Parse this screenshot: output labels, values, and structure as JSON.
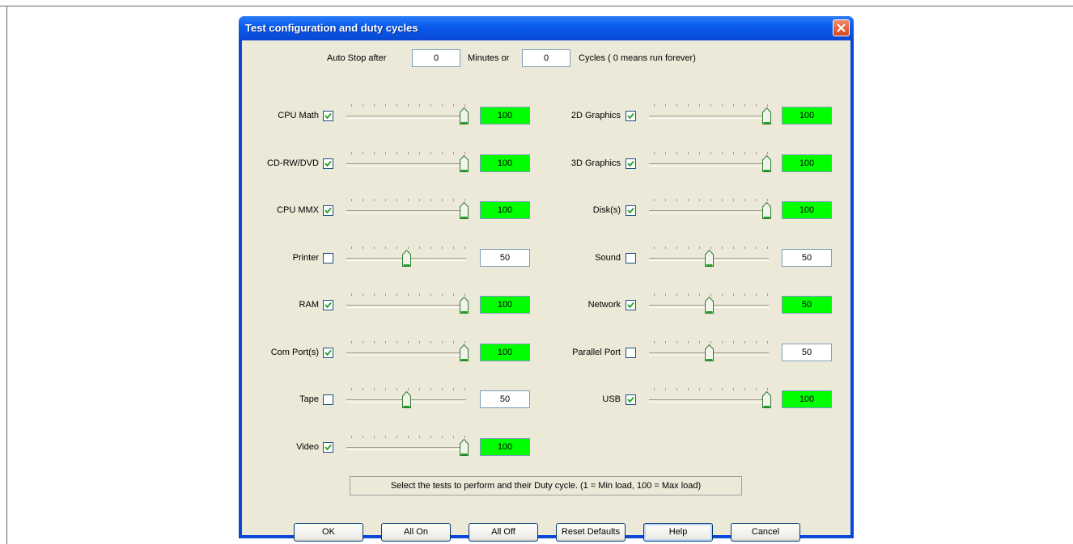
{
  "window": {
    "title": "Test configuration and duty cycles"
  },
  "autostop": {
    "label_before": "Auto Stop after",
    "minutes_value": "0",
    "label_middle": "Minutes or",
    "cycles_value": "0",
    "label_after": "Cycles ( 0 means run forever)"
  },
  "left_tests": [
    {
      "label": "CPU Math",
      "checked": true,
      "value": 100
    },
    {
      "label": "CD-RW/DVD",
      "checked": true,
      "value": 100
    },
    {
      "label": "CPU MMX",
      "checked": true,
      "value": 100
    },
    {
      "label": "Printer",
      "checked": false,
      "value": 50
    },
    {
      "label": "RAM",
      "checked": true,
      "value": 100
    },
    {
      "label": "Com Port(s)",
      "checked": true,
      "value": 100
    },
    {
      "label": "Tape",
      "checked": false,
      "value": 50
    },
    {
      "label": "Video",
      "checked": true,
      "value": 100
    }
  ],
  "right_tests": [
    {
      "label": "2D Graphics",
      "checked": true,
      "value": 100
    },
    {
      "label": "3D Graphics",
      "checked": true,
      "value": 100
    },
    {
      "label": "Disk(s)",
      "checked": true,
      "value": 100
    },
    {
      "label": "Sound",
      "checked": false,
      "value": 50
    },
    {
      "label": "Network",
      "checked": true,
      "value": 50
    },
    {
      "label": "Parallel Port",
      "checked": false,
      "value": 50
    },
    {
      "label": "USB",
      "checked": true,
      "value": 100
    }
  ],
  "info": "Select the tests to perform and their Duty cycle. (1 = Min load, 100 = Max load)",
  "buttons": {
    "ok": "OK",
    "all_on": "All On",
    "all_off": "All Off",
    "reset_defaults": "Reset Defaults",
    "help": "Help",
    "cancel": "Cancel"
  },
  "colors": {
    "enabled_value_bg": "#00ff00",
    "disabled_value_bg": "#ffffff"
  }
}
